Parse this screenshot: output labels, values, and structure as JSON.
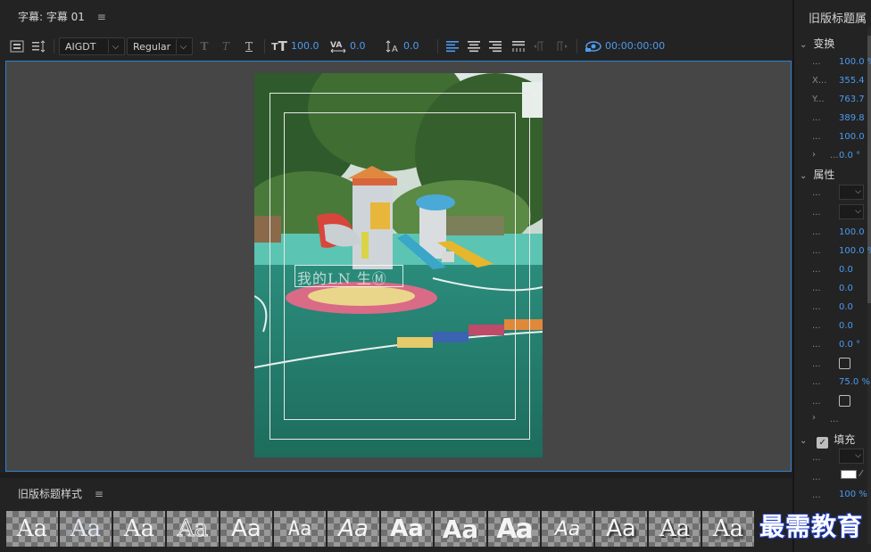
{
  "main_panel": {
    "tab_label": "字幕: 字幕 01",
    "menu_icon": "hamburger-icon"
  },
  "toolbar": {
    "font_family": "AIGDT",
    "font_style": "Regular",
    "font_size": "100.0",
    "kerning": "0.0",
    "leading": "0.0",
    "timecode": "00:00:00:00"
  },
  "canvas": {
    "overlay_text": "我的LN 生Ⓜ"
  },
  "styles_panel": {
    "title": "旧版标题样式",
    "swatch_label": "Aa",
    "swatch_count": 14
  },
  "properties_panel": {
    "title": "旧版标题属",
    "section_transform": "变换",
    "section_properties": "属性",
    "section_fill": "填充",
    "transform_rows": [
      {
        "label": "...",
        "value": "100.0 %"
      },
      {
        "label": "X...",
        "value": "355.4"
      },
      {
        "label": "Y...",
        "value": "763.7"
      },
      {
        "label": "...",
        "value": "389.8"
      },
      {
        "label": "...",
        "value": "100.0"
      },
      {
        "label": "...",
        "value": "0.0 °"
      }
    ],
    "property_rows": [
      {
        "label": "...",
        "value": "100.0"
      },
      {
        "label": "...",
        "value": "100.0 %"
      },
      {
        "label": "...",
        "value": "0.0"
      },
      {
        "label": "...",
        "value": "0.0"
      },
      {
        "label": "...",
        "value": "0.0"
      },
      {
        "label": "...",
        "value": "0.0"
      },
      {
        "label": "...",
        "value": "0.0 °"
      },
      {
        "label": "...",
        "value": "75.0 %"
      }
    ],
    "fill_opacity": "100 %",
    "fill_color": "#ffffff"
  },
  "watermark": {
    "text": "最需教育"
  },
  "colors": {
    "accent": "#4d9af0",
    "frame_border": "#2d7fd3",
    "panel_bg": "#232323"
  }
}
